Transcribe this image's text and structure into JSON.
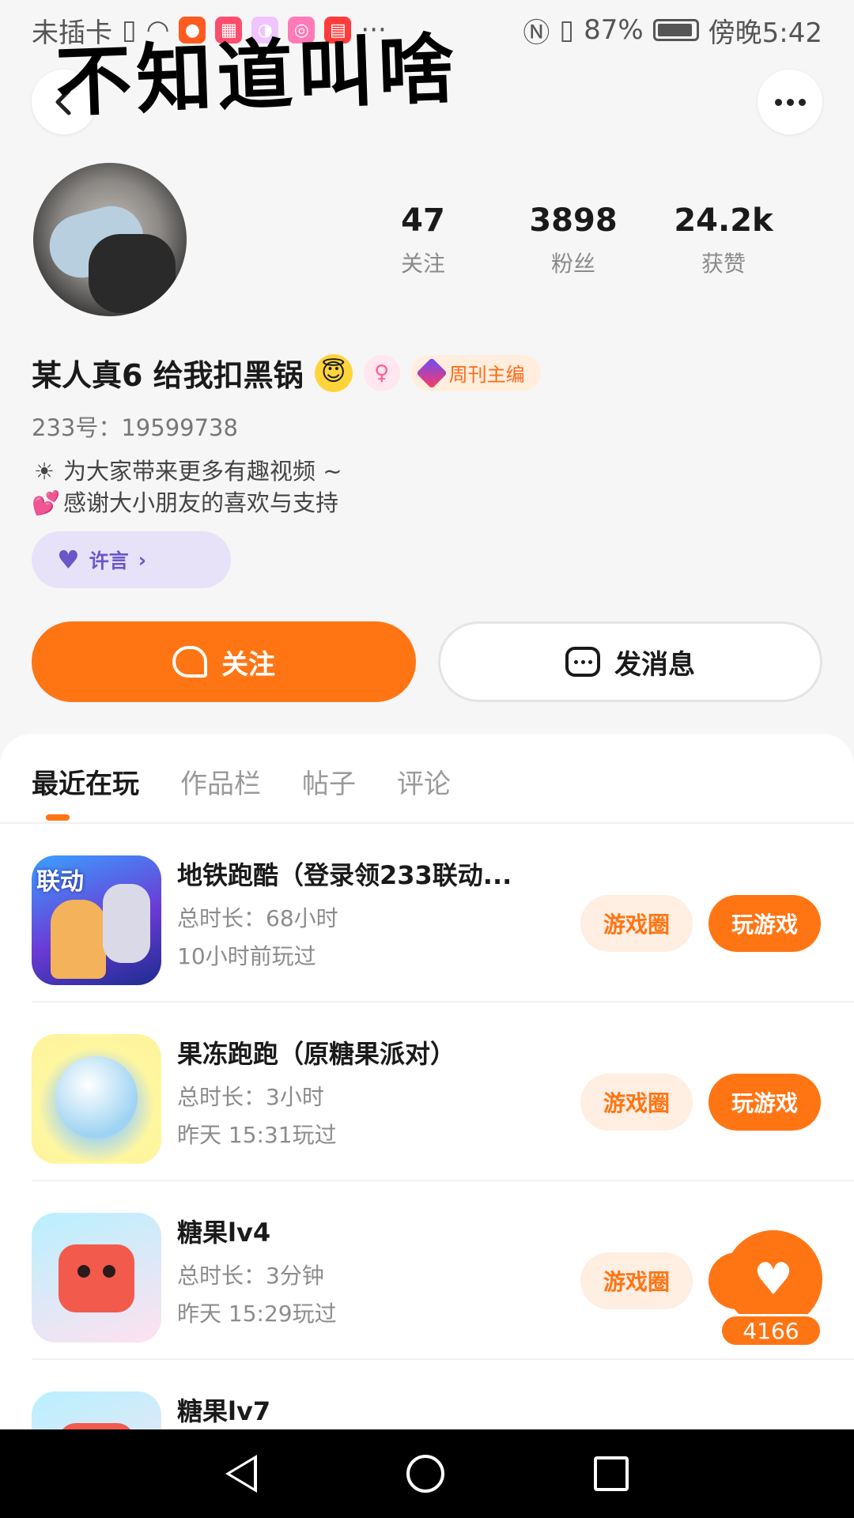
{
  "status_bar": {
    "carrier": "未插卡",
    "battery": "87%",
    "time": "傍晚5:42",
    "more": "···"
  },
  "overlay_title": "不知道叫啥",
  "profile": {
    "stats": [
      {
        "value": "47",
        "label": "关注"
      },
      {
        "value": "3898",
        "label": "粉丝"
      },
      {
        "value": "24.2k",
        "label": "获赞"
      }
    ],
    "name": "某人真6 给我扣黑锅",
    "name_emoji": "😇",
    "gender_symbol": "♀",
    "badge": "周刊主编",
    "uid": "233号：19599738",
    "bio": [
      {
        "icon": "☀",
        "text": "为大家带来更多有趣视频 ~"
      },
      {
        "icon": "💕",
        "text": "感谢大小朋友的喜欢与支持"
      }
    ],
    "wish": {
      "label": "许言",
      "suffix": "›"
    }
  },
  "actions": {
    "follow_label": "关注",
    "message_label": "发消息"
  },
  "tabs": [
    {
      "label": "最近在玩",
      "active": true
    },
    {
      "label": "作品栏",
      "active": false
    },
    {
      "label": "帖子",
      "active": false
    },
    {
      "label": "评论",
      "active": false
    }
  ],
  "games": [
    {
      "title": "地铁跑酷（登录领233联动...",
      "duration": "总时长：68小时",
      "last_played": "10小时前玩过",
      "icon_label": "联动"
    },
    {
      "title": "果冻跑跑（原糖果派对）",
      "duration": "总时长：3小时",
      "last_played": "昨天 15:31玩过"
    },
    {
      "title": "糖果lv4",
      "duration": "总时长：3分钟",
      "last_played": "昨天 15:29玩过"
    },
    {
      "title": "糖果lv7",
      "duration": "",
      "last_played": ""
    }
  ],
  "game_buttons": {
    "circle": "游戏圈",
    "play": "玩游戏"
  },
  "float_like_count": "4166",
  "colors": {
    "accent": "#ff7514",
    "accent_light": "#ffeee2",
    "wish_bg": "#e7e2f7"
  }
}
